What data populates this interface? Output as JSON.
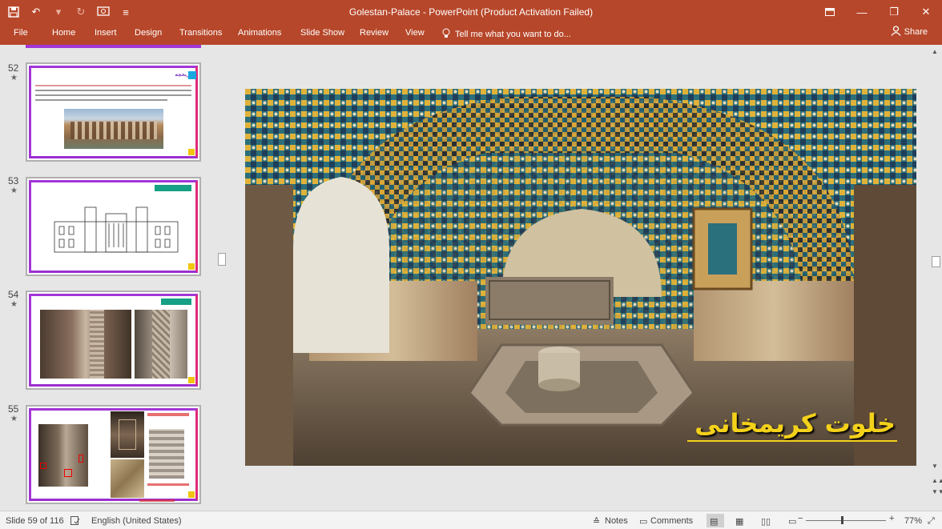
{
  "window": {
    "title": "Golestan-Palace - PowerPoint (Product Activation Failed)"
  },
  "ribbon": {
    "tabs": [
      "File",
      "Home",
      "Insert",
      "Design",
      "Transitions",
      "Animations",
      "Slide Show",
      "Review",
      "View"
    ],
    "tell_me": "Tell me what you want to do...",
    "share": "Share"
  },
  "thumbnails": [
    {
      "number": "52",
      "title": "تاریخچه",
      "star": "★"
    },
    {
      "number": "53",
      "title": "",
      "star": "★"
    },
    {
      "number": "54",
      "title": "",
      "star": "★"
    },
    {
      "number": "55",
      "title": "",
      "star": "★"
    }
  ],
  "slide": {
    "caption": "خلوت کریمخانی"
  },
  "status": {
    "slide_info": "Slide 59 of 116",
    "language": "English (United States)",
    "notes": "Notes",
    "comments": "Comments",
    "zoom": "77%"
  },
  "colors": {
    "ribbon": "#b7472a",
    "thumb_frame": "#a236d6",
    "caption": "#f4d11a"
  }
}
